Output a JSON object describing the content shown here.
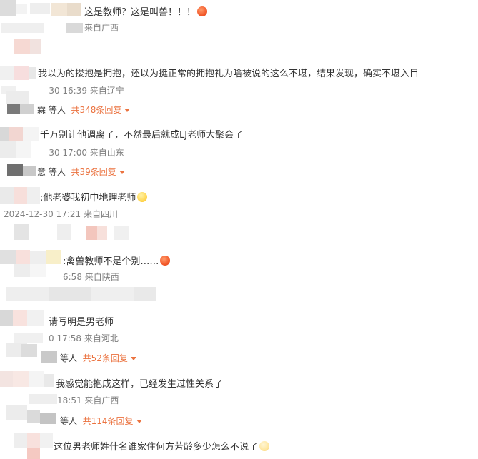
{
  "colors": {
    "text": "#333333",
    "meta": "#808080",
    "accent": "#eb7340",
    "mosaic": "#e9e9e9"
  },
  "comments": [
    {
      "text": "这是教师？这是叫兽！！！",
      "emoji": "angry-face-icon",
      "meta": "来自广西"
    },
    {
      "text": "我以为的搂抱是拥抱，还以为挺正常的拥抱礼为啥被说的这么不堪，结果发现，确实不堪入目",
      "meta": "-30 16:39 来自辽宁",
      "reply": {
        "prefix": "霖 等人",
        "link": "共348条回复"
      }
    },
    {
      "text": "千万别让他调离了，不然最后就成LJ老师大聚会了",
      "meta": "-30 17:00 来自山东",
      "reply": {
        "prefix": "意 等人",
        "link": "共39条回复"
      }
    },
    {
      "text": ":他老婆我初中地理老师",
      "emoji": "laughing-crying-icon",
      "meta": "2024-12-30 17:21 来自四川"
    },
    {
      "text": ":禽兽教师不是个别……",
      "emoji": "angry-face-icon",
      "meta": "6:58 来自陕西"
    },
    {
      "text": "请写明是男老师",
      "meta": "0 17:58 来自河北",
      "reply": {
        "prefix": "等人",
        "link": "共52条回复"
      }
    },
    {
      "text": "我感觉能抱成这样，已经发生过性关系了",
      "meta": "18:51 来自广西",
      "reply": {
        "prefix": "等人",
        "link": "共114条回复"
      }
    },
    {
      "text": "这位男老师姓什名谁家住何方芳龄多少怎么不说了",
      "emoji": "cat-face-icon"
    }
  ]
}
